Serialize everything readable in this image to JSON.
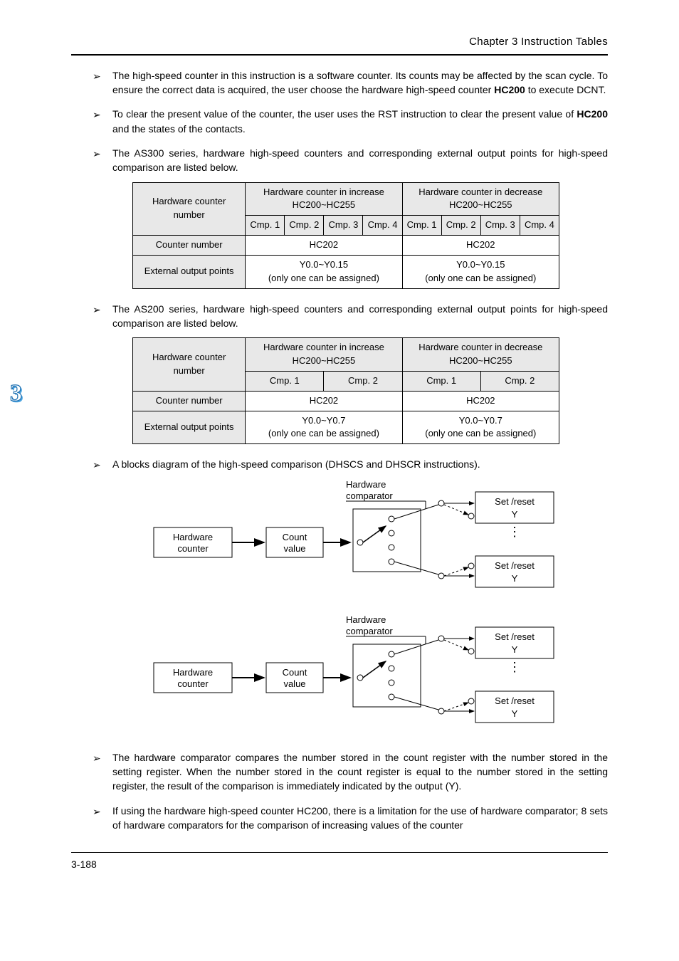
{
  "header": {
    "chapter_line": "Chapter 3 Instruction Tables"
  },
  "bullets": [
    {
      "text_parts": [
        "The high-speed counter in this instruction is a software counter. Its counts may be affected by the scan cycle. To ensure the correct data is acquired, the user choose the hardware high-speed counter ",
        " to execute DCNT."
      ],
      "bold": "HC200"
    },
    {
      "text_parts": [
        "To clear the present value of the counter, the user uses the RST instruction to clear the present value of ",
        " and the states of the contacts."
      ],
      "bold": "HC200"
    },
    {
      "text": "The AS300 series, hardware high-speed counters and corresponding external output points for high-speed comparison are listed below."
    },
    {
      "text": "The AS200 series, hardware high-speed counters and corresponding external output points for high-speed comparison are listed below."
    },
    {
      "text": "A blocks diagram of the high-speed comparison (DHSCS and DHSCR instructions)."
    },
    {
      "text": "The hardware comparator compares the number stored in the count register with the number stored in the setting register. When the number stored in the count register is equal to the number stored in the setting register, the result of the comparison is immediately indicated by the output (Y)."
    },
    {
      "text": "If using the hardware high-speed counter HC200, there is a limitation for the use of hardware comparator; 8 sets of hardware comparators for the comparison of increasing values of the counter"
    }
  ],
  "table300": {
    "headers": {
      "col1": "Hardware counter number",
      "col2": "Hardware counter in increase\nHC200~HC255",
      "col3": "Hardware counter in decrease\nHC200~HC255",
      "cmp_cells": [
        "Cmp. 1",
        "Cmp. 2",
        "Cmp. 3",
        "Cmp. 4",
        "Cmp. 1",
        "Cmp. 2",
        "Cmp. 3",
        "Cmp. 4"
      ]
    },
    "rows": [
      {
        "label": "Counter number",
        "left": "HC202",
        "right": "HC202"
      },
      {
        "label": "External output points",
        "left": "Y0.0~Y0.15\n(only one can be assigned)",
        "right": "Y0.0~Y0.15\n(only one can be assigned)"
      }
    ]
  },
  "table200": {
    "headers": {
      "col1": "Hardware counter number",
      "col2": "Hardware counter in increase\nHC200~HC255",
      "col3": "Hardware counter in decrease\nHC200~HC255",
      "cmp_cells": [
        "Cmp. 1",
        "Cmp. 2",
        "Cmp. 1",
        "Cmp. 2"
      ]
    },
    "rows": [
      {
        "label": "Counter number",
        "left": "HC202",
        "right": "HC202"
      },
      {
        "label": "External output points",
        "left": "Y0.0~Y0.7\n(only one can be assigned)",
        "right": "Y0.0~Y0.7\n(only one can be assigned)"
      }
    ]
  },
  "diagram": {
    "hw_counter": "Hardware\ncounter",
    "count_value": "Count\nvalue",
    "hw_comparator": "Hardware\ncomparator",
    "set_reset": "Set /reset",
    "y_top": "Y",
    "y_bottom": "Y"
  },
  "footer": {
    "page_number": "3-188"
  }
}
